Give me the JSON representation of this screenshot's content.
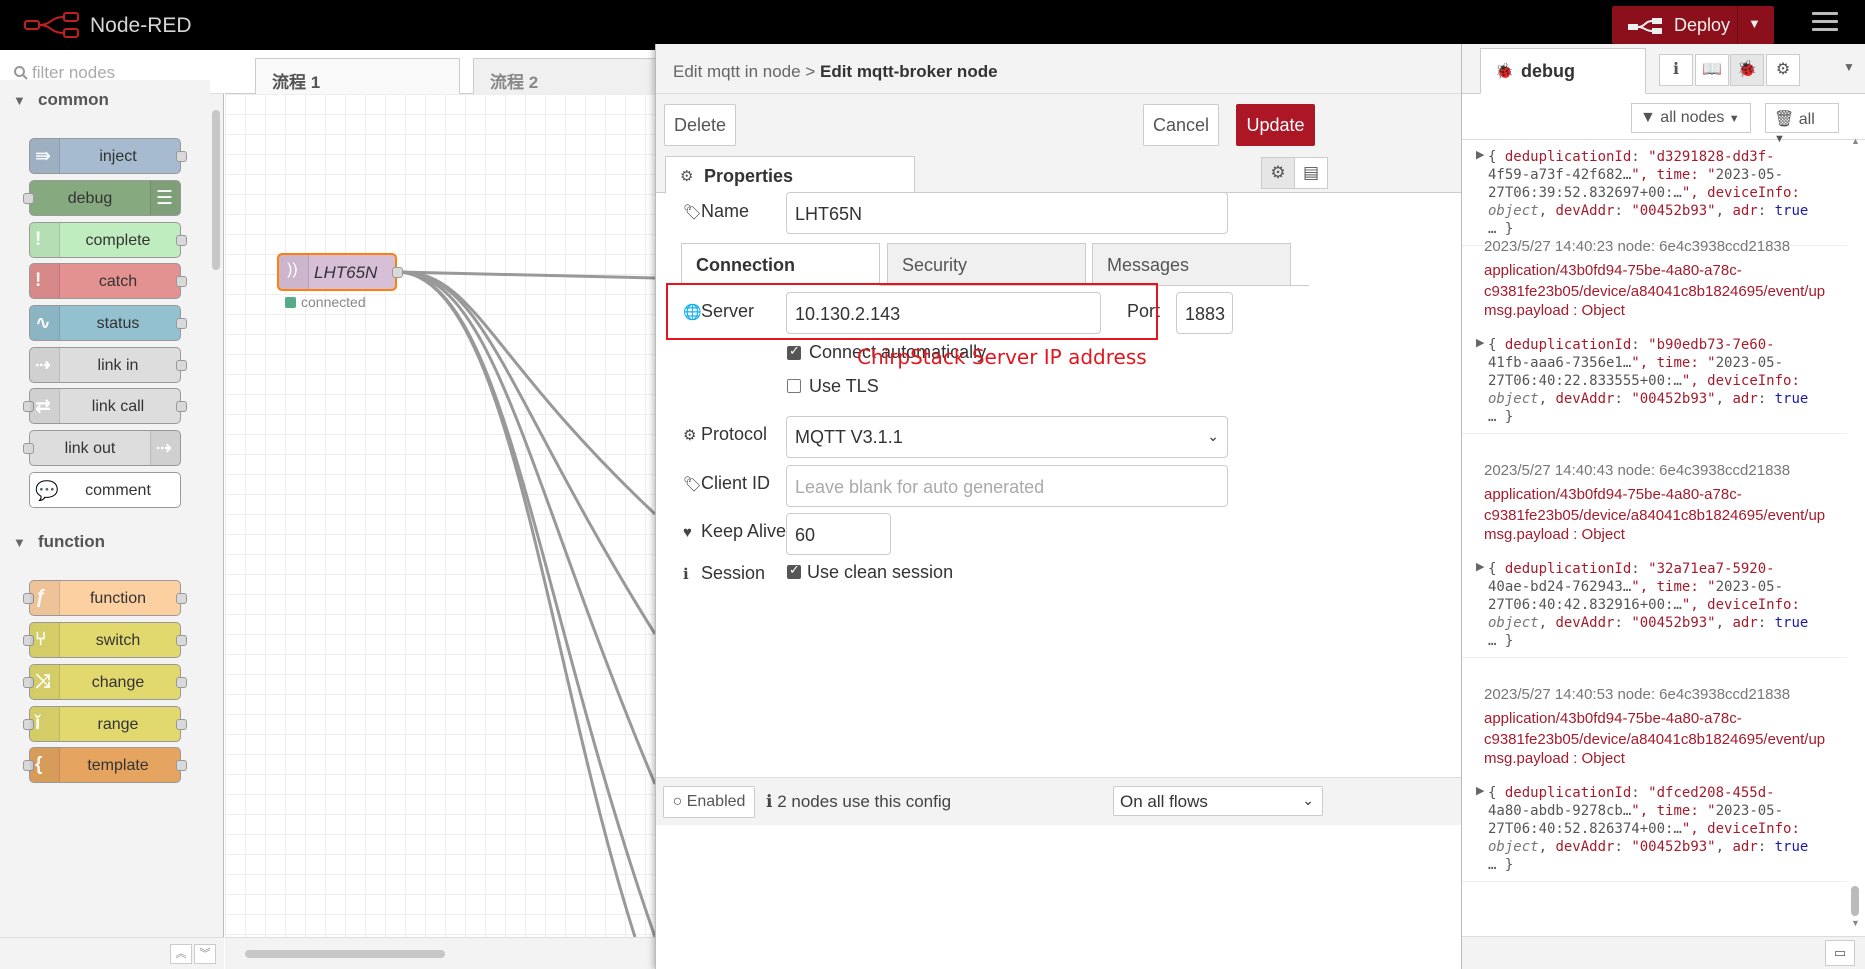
{
  "app": {
    "title": "Node-RED"
  },
  "header": {
    "deploy_label": "Deploy"
  },
  "palette": {
    "search_placeholder": "filter nodes",
    "categories": [
      {
        "label": "common",
        "nodes": [
          "inject",
          "debug",
          "complete",
          "catch",
          "status",
          "link in",
          "link call",
          "link out",
          "comment"
        ]
      },
      {
        "label": "function",
        "nodes": [
          "function",
          "switch",
          "change",
          "range",
          "template"
        ]
      }
    ]
  },
  "workspace": {
    "tabs": [
      "流程 1",
      "流程 2"
    ],
    "node": {
      "label": "LHT65N",
      "status": "connected"
    }
  },
  "tray": {
    "breadcrumb_parent": "Edit mqtt in node",
    "breadcrumb_sep": ">",
    "breadcrumb_current": "Edit mqtt-broker node",
    "delete_label": "Delete",
    "cancel_label": "Cancel",
    "update_label": "Update",
    "properties_tab": "Properties",
    "name_label": "Name",
    "name_value": "LHT65N",
    "subtabs": [
      "Connection",
      "Security",
      "Messages"
    ],
    "server_label": "Server",
    "server_value": "10.130.2.143",
    "port_label": "Port",
    "port_value": "1883",
    "connect_auto_label": "Connect automatically",
    "use_tls_label": "Use TLS",
    "protocol_label": "Protocol",
    "protocol_value": "MQTT V3.1.1",
    "client_id_label": "Client ID",
    "client_id_placeholder": "Leave blank for auto generated",
    "keep_alive_label": "Keep Alive",
    "keep_alive_value": "60",
    "session_label": "Session",
    "clean_session_label": "Use clean session",
    "annotation": "ChirpStack Server IP address",
    "enabled_label": "Enabled",
    "nodes_use_config": "2 nodes use this config",
    "scope_value": "On all flows"
  },
  "sidebar": {
    "tab_label": "debug",
    "filter_nodes_label": "all nodes",
    "clear_label": "all",
    "messages": [
      {
        "object_lines": [
          "{ deduplicationId: \"d3291828-dd3f-",
          "4f59-a73f-42f682…\", time: \"2023-05-",
          "27T06:39:52.832697+00:…\", deviceInfo:",
          "object, devAddr: \"00452b93\", adr: true",
          "… }"
        ]
      },
      {
        "meta": "2023/5/27 14:40:23  node: 6e4c3938ccd21838",
        "topic_lines": [
          "application/43b0fd94-75be-4a80-a78c-",
          "c9381fe23b05/device/a84041c8b1824695/event/up"
        ],
        "type": "msg.payload : Object",
        "object_lines": [
          "{ deduplicationId: \"b90edb73-7e60-",
          "41fb-aaa6-7356e1…\", time: \"2023-05-",
          "27T06:40:22.833555+00:…\", deviceInfo:",
          "object, devAddr: \"00452b93\", adr: true",
          "… }"
        ]
      },
      {
        "meta": "2023/5/27 14:40:43  node: 6e4c3938ccd21838",
        "topic_lines": [
          "application/43b0fd94-75be-4a80-a78c-",
          "c9381fe23b05/device/a84041c8b1824695/event/up"
        ],
        "type": "msg.payload : Object",
        "object_lines": [
          "{ deduplicationId: \"32a71ea7-5920-",
          "40ae-bd24-762943…\", time: \"2023-05-",
          "27T06:40:42.832916+00:…\", deviceInfo:",
          "object, devAddr: \"00452b93\", adr: true",
          "… }"
        ]
      },
      {
        "meta": "2023/5/27 14:40:53  node: 6e4c3938ccd21838",
        "topic_lines": [
          "application/43b0fd94-75be-4a80-a78c-",
          "c9381fe23b05/device/a84041c8b1824695/event/up"
        ],
        "type": "msg.payload : Object",
        "object_lines": [
          "{ deduplicationId: \"dfced208-455d-",
          "4a80-abdb-9278cb…\", time: \"2023-05-",
          "27T06:40:52.826374+00:…\", deviceInfo:",
          "object, devAddr: \"00452b93\", adr: true",
          "… }"
        ]
      }
    ]
  },
  "colors": {
    "header_bg": "#000000",
    "deploy_bg": "#8c101c",
    "update_bg": "#ad1625",
    "annotation": "#e3161e",
    "node_fill": "#d8bfd8",
    "node_selected_border": "#ff7f0e"
  },
  "icons": [
    "node-red-logo-icon",
    "deploy-icon",
    "menu-icon",
    "search-icon",
    "gear-icon",
    "info-icon",
    "book-icon",
    "bug-icon",
    "tag-icon",
    "globe-icon",
    "heart-icon",
    "filter-icon",
    "trash-icon"
  ]
}
